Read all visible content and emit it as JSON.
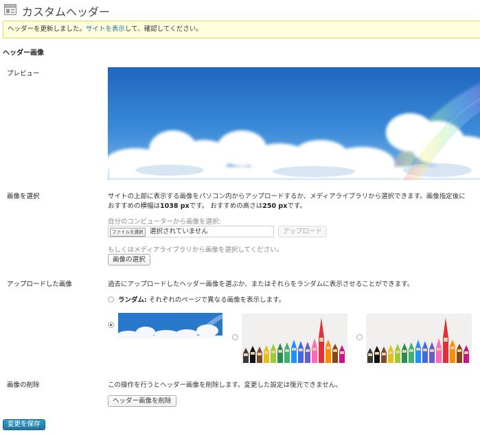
{
  "header": {
    "title": "カスタムヘッダー",
    "icon": "appearance-header-icon"
  },
  "notice": {
    "prefix": "ヘッダーを更新しました。",
    "link": "サイトを表示",
    "suffix": "して、確認してください。"
  },
  "section_title": "ヘッダー画像",
  "preview": {
    "label": "プレビュー"
  },
  "select_image": {
    "label": "画像を選択",
    "desc_line1": "サイトの上部に表示する画像をパソコン内からアップロードするか、メディアライブラリから選択できます。画像指定後に",
    "rec_width_prefix": "おすすめの横幅は",
    "rec_width": "1038 px",
    "rec_width_suffix": "です。 おすすめの高さは",
    "rec_height": "250 px",
    "rec_height_suffix": "です。",
    "upload_prompt": "自分のコンピューターから画像を選択:",
    "file_button": "ファイルを選択",
    "file_status": "選択されていません",
    "upload_button": "アップロード",
    "library_prompt": "もしくはメディアライブラリから画像を選択してください。",
    "library_button": "画像の選択"
  },
  "uploaded": {
    "label": "アップロードした画像",
    "desc": "過去にアップロードしたヘッダー画像を選ぶか、またはそれらをランダムに表示させることができます。",
    "random_label": "ランダム:",
    "random_desc": " それぞれのページで異なる画像を表示します。",
    "images": [
      {
        "name": "sky-clouds-rainbow",
        "selected": true
      },
      {
        "name": "colored-pencils",
        "selected": false
      },
      {
        "name": "colored-pencils",
        "selected": false
      }
    ]
  },
  "remove": {
    "label": "画像の削除",
    "desc": "この操作を行うとヘッダー画像を削除します。変更した設定は復元できません。",
    "button": "ヘッダー画像を削除"
  },
  "save_button": "変更を保存",
  "colors": {
    "notice_bg": "#ffffe0",
    "notice_border": "#e6db55",
    "link": "#21759b",
    "primary_button": "#21759b",
    "sky": "#2f7fd0"
  }
}
